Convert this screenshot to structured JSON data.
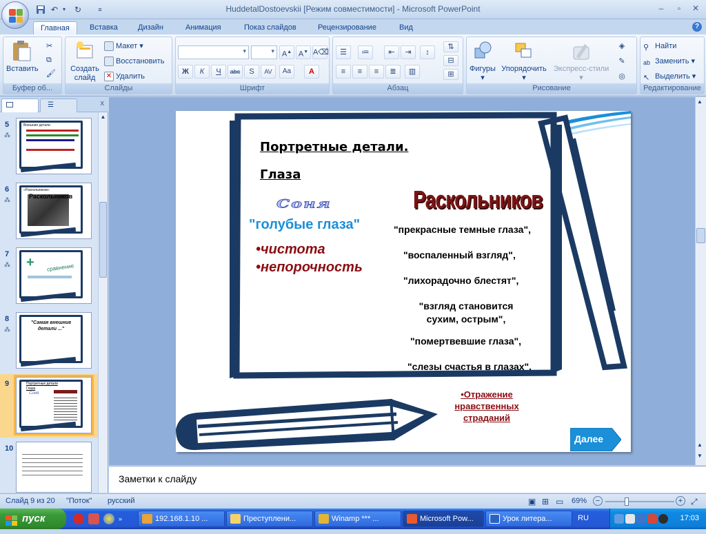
{
  "window": {
    "title": "HuddetalDostoevskii [Режим совместимости] - Microsoft PowerPoint"
  },
  "ribbon_tabs": [
    "Главная",
    "Вставка",
    "Дизайн",
    "Анимация",
    "Показ слайдов",
    "Рецензирование",
    "Вид"
  ],
  "ribbon": {
    "clipboard": {
      "label": "Буфер об...",
      "paste": "Вставить"
    },
    "slides": {
      "label": "Слайды",
      "create": "Создать слайд",
      "layout": "Макет",
      "reset": "Восстановить",
      "delete": "Удалить"
    },
    "font": {
      "label": "Шрифт"
    },
    "paragraph": {
      "label": "Абзац"
    },
    "drawing": {
      "label": "Рисование",
      "shapes": "Фигуры",
      "arrange": "Упорядочить",
      "styles": "Экспресс-стили"
    },
    "editing": {
      "label": "Редактирование",
      "find": "Найти",
      "replace": "Заменить",
      "select": "Выделить"
    }
  },
  "thumbnails": [
    {
      "num": "5",
      "lines": [
        "Внешние детали",
        "...",
        "..."
      ]
    },
    {
      "num": "6",
      "lines": [
        "«Раскольников»",
        "Раскольников"
      ]
    },
    {
      "num": "7",
      "lines": [
        "+",
        "сравнение"
      ]
    },
    {
      "num": "8",
      "lines": [
        "\"Самая внешние детали ...\""
      ]
    },
    {
      "num": "9",
      "lines": [
        "Портретные детали",
        "Глаза",
        "Соня"
      ]
    },
    {
      "num": "10",
      "lines": [
        "1.",
        "2.",
        "3."
      ]
    }
  ],
  "slide": {
    "heading1": "Портретные   детали.",
    "heading2": "Глаза",
    "sonya_title": "Соня",
    "sonya_eyes": "\"голубые глаза\"",
    "sonya_bullets": [
      "•чистота",
      "•непорочность"
    ],
    "rask_title": "Раскольников",
    "rask_quotes": [
      "\"прекрасные темные глаза\",",
      "\"воспаленный взгляд\",",
      "\"лихорадочно блестят\",",
      "\"взгляд становится\nсухим, острым\",",
      "\"помертвевшие глаза\",",
      "\"слезы счастья в глазах\"."
    ],
    "link": "•Отражение нравственных страданий",
    "next_button": "Далее"
  },
  "notes_placeholder": "Заметки к слайду",
  "status": {
    "slide": "Слайд 9 из 20",
    "theme": "\"Поток\"",
    "language": "русский",
    "zoom": "69%",
    "zoom_fraction": 0.69
  },
  "taskbar": {
    "start": "пуск",
    "buttons": [
      "192.168.1.10 ...",
      "Преступлени...",
      "Winamp *** ...",
      "Microsoft Pow...",
      "Урок литера..."
    ],
    "lang": "RU",
    "clock": "17:03"
  },
  "colors": {
    "frame": "#1b3a63",
    "accent_blue": "#1b8fd8",
    "dark_red": "#8b0d13"
  }
}
